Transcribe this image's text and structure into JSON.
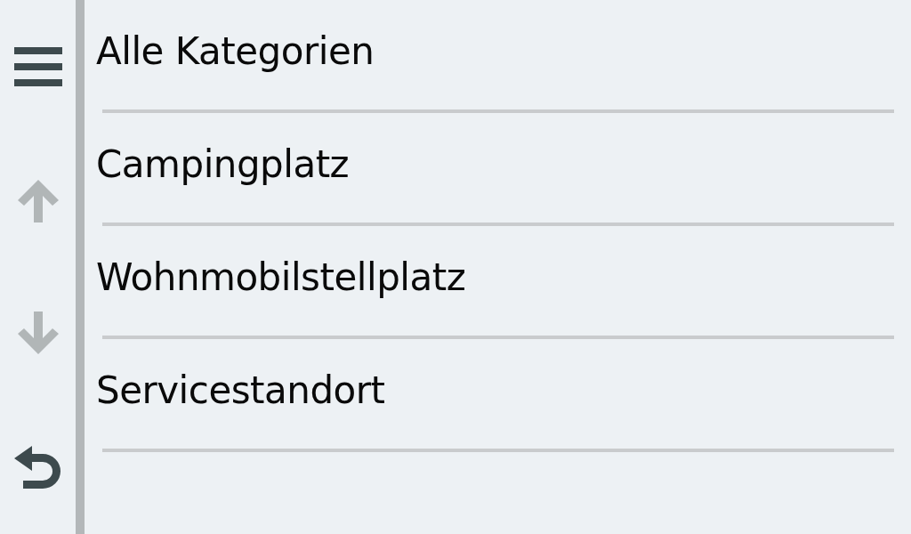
{
  "sidebar": {
    "buttons": [
      {
        "kind": "menu",
        "disabled": false
      },
      {
        "kind": "up",
        "disabled": true
      },
      {
        "kind": "down",
        "disabled": true
      },
      {
        "kind": "back",
        "disabled": false
      }
    ]
  },
  "list": {
    "items": [
      {
        "label": "Alle Kategorien"
      },
      {
        "label": "Campingplatz"
      },
      {
        "label": "Wohnmobilstellplatz"
      },
      {
        "label": "Servicestandort"
      }
    ]
  }
}
